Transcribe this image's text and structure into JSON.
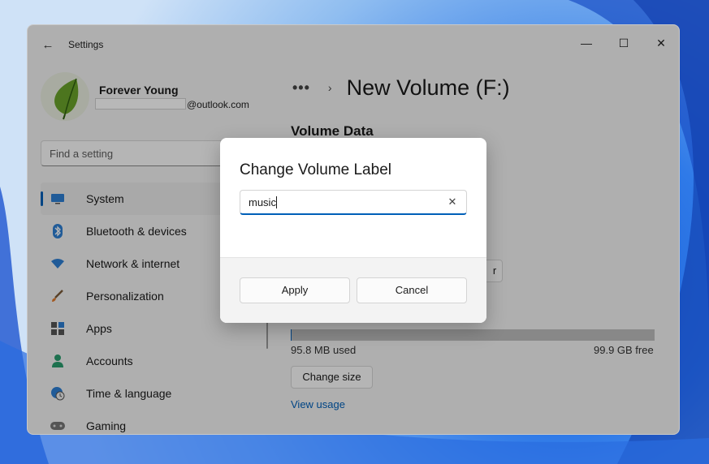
{
  "window": {
    "app_title": "Settings",
    "minimize_glyph": "—",
    "maximize_glyph": "☐",
    "close_glyph": "✕",
    "back_glyph": "←"
  },
  "profile": {
    "name": "Forever Young",
    "email_domain": "@outlook.com"
  },
  "search": {
    "placeholder": "Find a setting"
  },
  "nav": {
    "items": [
      {
        "label": "System",
        "icon": "monitor-icon",
        "active": true
      },
      {
        "label": "Bluetooth & devices",
        "icon": "bluetooth-icon"
      },
      {
        "label": "Network & internet",
        "icon": "wifi-icon"
      },
      {
        "label": "Personalization",
        "icon": "brush-icon"
      },
      {
        "label": "Apps",
        "icon": "apps-icon"
      },
      {
        "label": "Accounts",
        "icon": "person-icon"
      },
      {
        "label": "Time & language",
        "icon": "globe-clock-icon"
      },
      {
        "label": "Gaming",
        "icon": "gamepad-icon"
      }
    ]
  },
  "breadcrumb": {
    "more": "•••",
    "separator": "›",
    "title": "New Volume (F:)"
  },
  "main": {
    "section_title": "Volume Data",
    "partial_button_text": "r",
    "used": "95.8 MB used",
    "free": "99.9 GB free",
    "usage_fraction": 0.001,
    "change_size_label": "Change size",
    "view_usage_label": "View usage"
  },
  "dialog": {
    "title": "Change Volume Label",
    "input_value": "music",
    "clear_glyph": "✕",
    "apply_label": "Apply",
    "cancel_label": "Cancel"
  },
  "colors": {
    "accent": "#005fb8",
    "link": "#005fb8"
  }
}
